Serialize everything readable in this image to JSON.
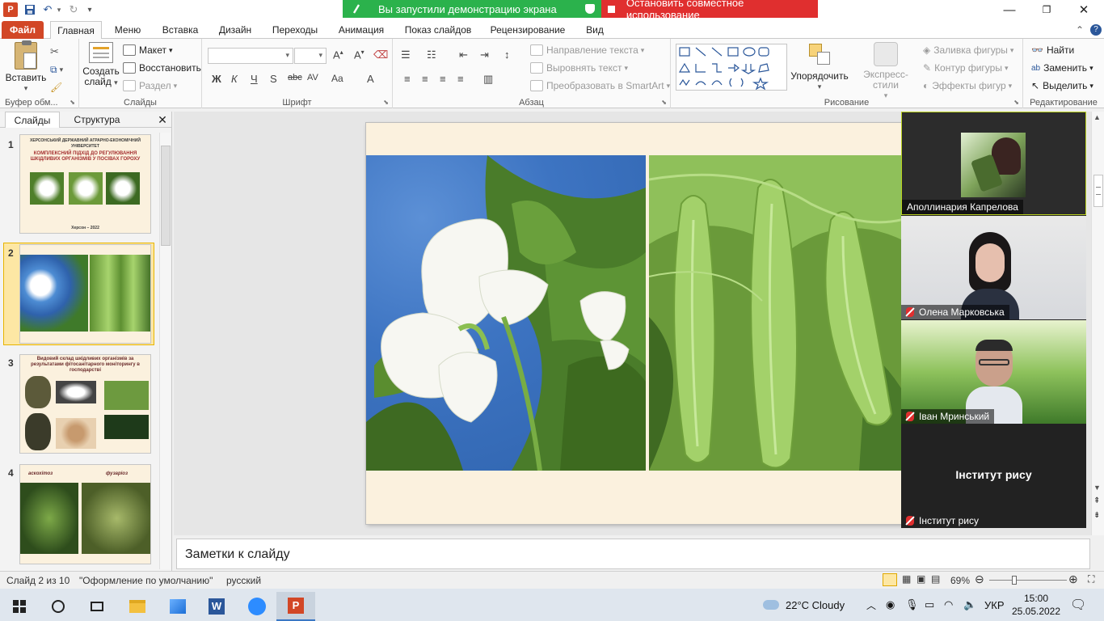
{
  "share": {
    "status": "Вы запустили демонстрацию экрана",
    "stop": "Остановить совместное использование"
  },
  "tabs": [
    "Файл",
    "Главная",
    "Меню",
    "Вставка",
    "Дизайн",
    "Переходы",
    "Анимация",
    "Показ слайдов",
    "Рецензирование",
    "Вид"
  ],
  "ribbon": {
    "clipboard": {
      "paste": "Вставить",
      "label": "Буфер обм..."
    },
    "slides": {
      "new_slide": "Создать слайд",
      "layout": "Макет",
      "reset": "Восстановить",
      "section": "Раздел",
      "label": "Слайды"
    },
    "font": {
      "label": "Шрифт",
      "bold": "Ж",
      "italic": "К",
      "underline": "Ч",
      "shadow": "S",
      "strike": "abc",
      "spacing": "AV",
      "case": "Aa",
      "color": "A"
    },
    "paragraph": {
      "label": "Абзац",
      "text_direction": "Направление текста",
      "align_text": "Выровнять текст",
      "smartart": "Преобразовать в SmartArt"
    },
    "drawing": {
      "arrange": "Упорядочить",
      "quick_styles": "Экспресс-стили",
      "fill": "Заливка фигуры",
      "outline": "Контур фигуры",
      "effects": "Эффекты фигур",
      "label": "Рисование"
    },
    "editing": {
      "find": "Найти",
      "replace": "Заменить",
      "select": "Выделить",
      "label": "Редактирование"
    }
  },
  "panel": {
    "tab_slides": "Слайды",
    "tab_outline": "Структура",
    "thumbs": [
      {
        "num": "1",
        "line1": "ХЕРСОНСЬКИЙ ДЕРЖАВНИЙ АГРАРНО-ЕКОНОМІЧНИЙ УНІВЕРСИТЕТ",
        "title": "КОМПЛЕКСНИЙ ПІДХІД ДО РЕГУЛЮВАННЯ ШКІДЛИВИХ ОРГАНІЗМІВ У ПОСІВАХ ГОРОХУ",
        "line2": "Херсон – 2022"
      },
      {
        "num": "2"
      },
      {
        "num": "3",
        "title": "Видовий склад шкідливих організмів за результатами фітосанітарного моніторингу в господарстві"
      },
      {
        "num": "4",
        "cap1": "аскохітоз",
        "cap2": "фузаріоз"
      }
    ]
  },
  "notes": "Заметки к слайду",
  "participants": [
    {
      "name": "Аполлинария Капрелова",
      "muted": false
    },
    {
      "name": "Олена Марковська",
      "muted": true
    },
    {
      "name": "Іван Мринський",
      "muted": true
    },
    {
      "name": "Інститут рису",
      "muted": true,
      "center_label": "Інститут рису"
    }
  ],
  "status": {
    "slide": "Слайд 2 из 10",
    "theme": "\"Оформление по умолчанию\"",
    "lang": "русский",
    "zoom": "69%"
  },
  "taskbar": {
    "weather": "22°C  Cloudy",
    "lang": "УКР",
    "time": "15:00",
    "date": "25.05.2022"
  },
  "colors": {
    "file_tab": "#d24726",
    "share_green": "#2bb24c",
    "share_red": "#e02f2f",
    "slide_bg": "#fbf1de",
    "selection": "#fde7a4"
  }
}
